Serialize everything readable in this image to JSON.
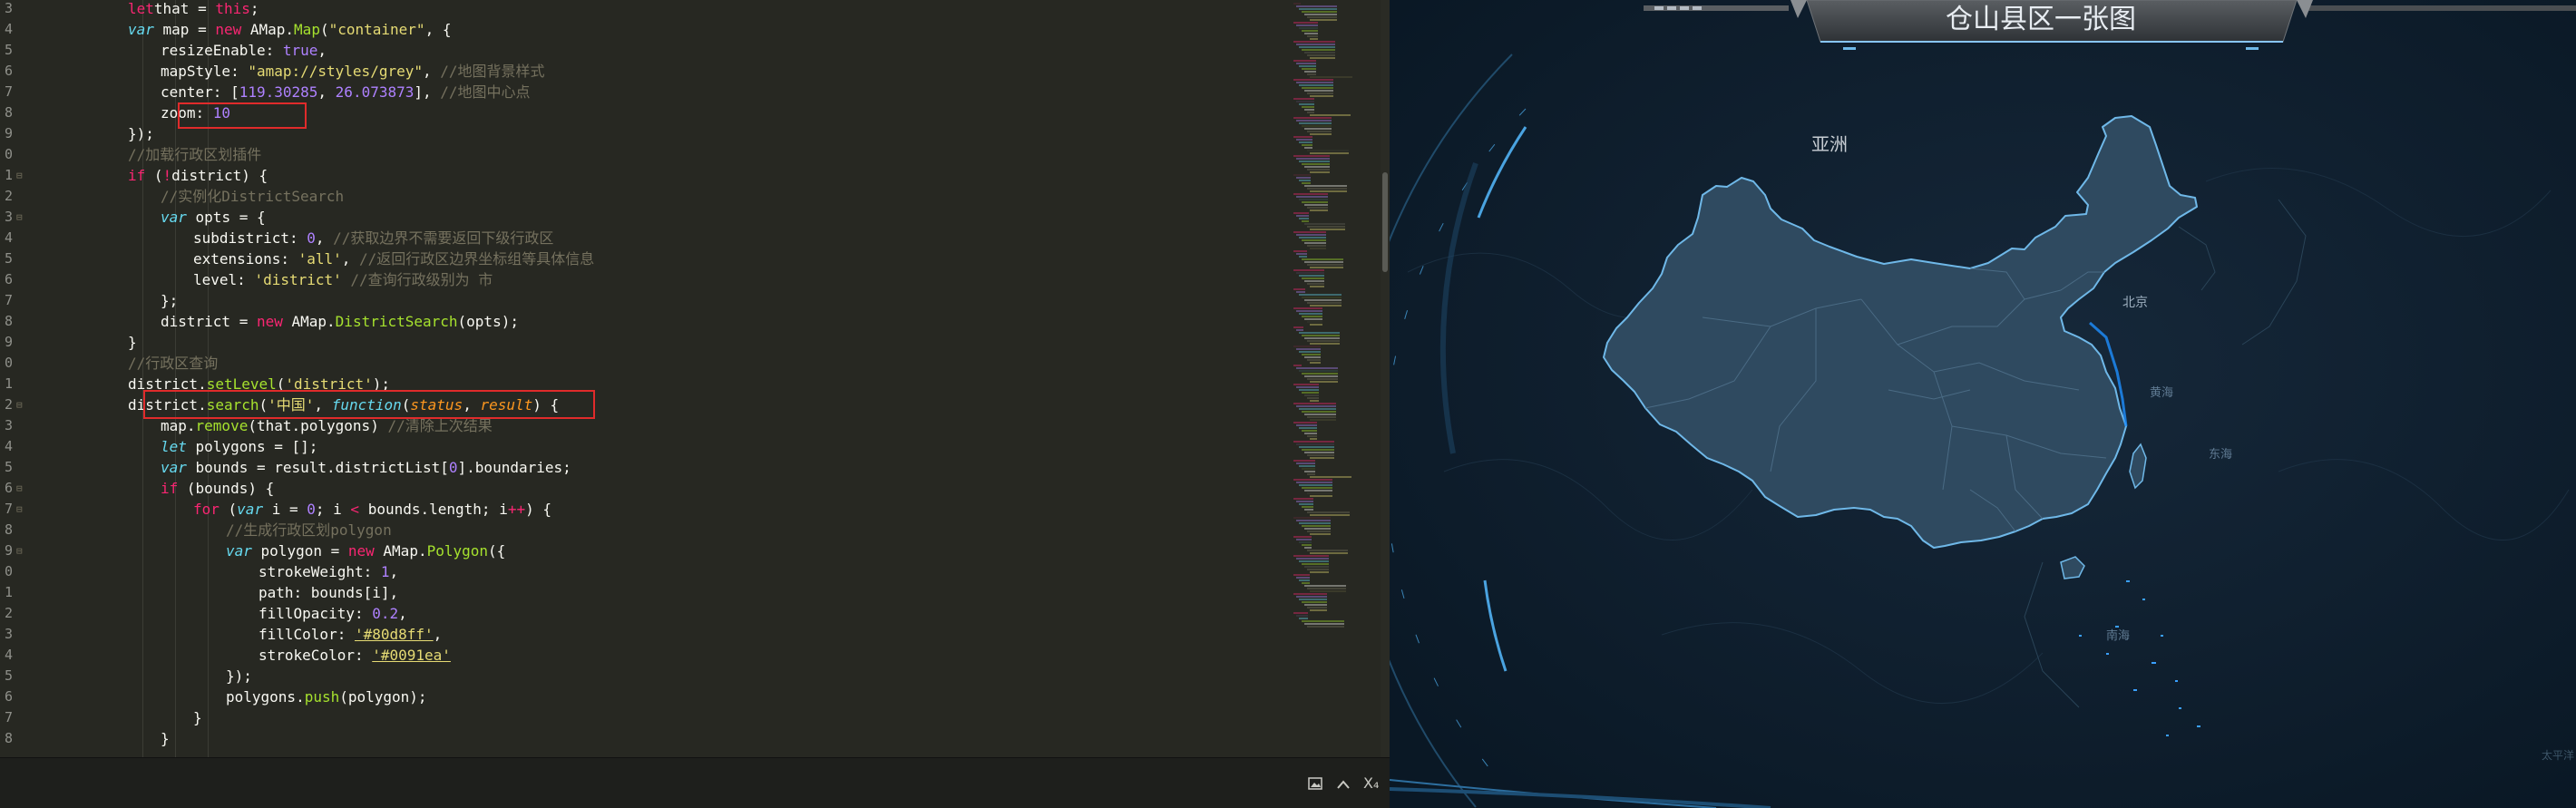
{
  "editor": {
    "lines": [
      {
        "n": "3",
        "fold": "",
        "indent": 0,
        "tokens": [
          [
            "kw",
            "let"
          ],
          [
            "",
            "that = "
          ],
          [
            "kw",
            "this"
          ],
          [
            "",
            ";"
          ]
        ]
      },
      {
        "n": "4",
        "fold": "",
        "indent": 0,
        "tokens": [
          [
            "st",
            "var"
          ],
          [
            "",
            " map = "
          ],
          [
            "kw",
            "new"
          ],
          [
            "",
            " AMap."
          ],
          [
            "fn",
            "Map"
          ],
          [
            "",
            "("
          ],
          [
            "str",
            "\"container\""
          ],
          [
            "",
            ", {"
          ]
        ]
      },
      {
        "n": "5",
        "fold": "",
        "indent": 1,
        "tokens": [
          [
            "",
            "resizeEnable: "
          ],
          [
            "num",
            "true"
          ],
          [
            "",
            ","
          ]
        ]
      },
      {
        "n": "6",
        "fold": "",
        "indent": 1,
        "tokens": [
          [
            "",
            "mapStyle: "
          ],
          [
            "str",
            "\"amap://styles/grey\""
          ],
          [
            "",
            ", "
          ],
          [
            "cm",
            "//地图背景样式"
          ]
        ]
      },
      {
        "n": "7",
        "fold": "",
        "indent": 1,
        "tokens": [
          [
            "",
            "center: ["
          ],
          [
            "num",
            "119.30285"
          ],
          [
            "",
            ", "
          ],
          [
            "num",
            "26.073873"
          ],
          [
            "",
            "], "
          ],
          [
            "cm",
            "//地图中心点"
          ]
        ]
      },
      {
        "n": "8",
        "fold": "",
        "indent": 1,
        "tokens": [
          [
            "",
            "zoom: "
          ],
          [
            "num",
            "10"
          ]
        ]
      },
      {
        "n": "9",
        "fold": "",
        "indent": 0,
        "tokens": [
          [
            "",
            "});"
          ]
        ]
      },
      {
        "n": "0",
        "fold": "",
        "indent": 0,
        "tokens": [
          [
            "cm",
            "//加载行政区划插件"
          ]
        ]
      },
      {
        "n": "1",
        "fold": "⊟",
        "indent": 0,
        "tokens": [
          [
            "kw",
            "if"
          ],
          [
            "",
            " ("
          ],
          [
            "kw",
            "!"
          ],
          [
            "",
            "district) {"
          ]
        ]
      },
      {
        "n": "2",
        "fold": "",
        "indent": 1,
        "tokens": [
          [
            "cm",
            "//实例化DistrictSearch"
          ]
        ]
      },
      {
        "n": "3",
        "fold": "⊟",
        "indent": 1,
        "tokens": [
          [
            "st",
            "var"
          ],
          [
            "",
            " opts = {"
          ]
        ]
      },
      {
        "n": "4",
        "fold": "",
        "indent": 2,
        "tokens": [
          [
            "",
            "subdistrict: "
          ],
          [
            "num",
            "0"
          ],
          [
            "",
            ", "
          ],
          [
            "cm",
            "//获取边界不需要返回下级行政区"
          ]
        ]
      },
      {
        "n": "5",
        "fold": "",
        "indent": 2,
        "tokens": [
          [
            "",
            "extensions: "
          ],
          [
            "str",
            "'all'"
          ],
          [
            "",
            ", "
          ],
          [
            "cm",
            "//返回行政区边界坐标组等具体信息"
          ]
        ]
      },
      {
        "n": "6",
        "fold": "",
        "indent": 2,
        "tokens": [
          [
            "",
            "level: "
          ],
          [
            "str",
            "'district'"
          ],
          [
            "",
            " "
          ],
          [
            "cm",
            "//查询行政级别为 市"
          ]
        ]
      },
      {
        "n": "7",
        "fold": "",
        "indent": 1,
        "tokens": [
          [
            "",
            "};"
          ]
        ]
      },
      {
        "n": "8",
        "fold": "",
        "indent": 1,
        "tokens": [
          [
            "",
            "district = "
          ],
          [
            "kw",
            "new"
          ],
          [
            "",
            " AMap."
          ],
          [
            "fn",
            "DistrictSearch"
          ],
          [
            "",
            "(opts);"
          ]
        ]
      },
      {
        "n": "9",
        "fold": "",
        "indent": 0,
        "tokens": [
          [
            "",
            "}"
          ]
        ]
      },
      {
        "n": "0",
        "fold": "",
        "indent": 0,
        "tokens": [
          [
            "cm",
            "//行政区查询"
          ]
        ]
      },
      {
        "n": "1",
        "fold": "",
        "indent": 0,
        "tokens": [
          [
            "",
            "district."
          ],
          [
            "fn",
            "setLevel"
          ],
          [
            "",
            "("
          ],
          [
            "str",
            "'district'"
          ],
          [
            "",
            ");"
          ]
        ]
      },
      {
        "n": "2",
        "fold": "⊟",
        "indent": 0,
        "tokens": [
          [
            "",
            "district."
          ],
          [
            "fn",
            "search"
          ],
          [
            "",
            "("
          ],
          [
            "str",
            "'中国'"
          ],
          [
            "",
            ", "
          ],
          [
            "st",
            "function"
          ],
          [
            "",
            "("
          ],
          [
            "par",
            "status"
          ],
          [
            "",
            ", "
          ],
          [
            "par",
            "result"
          ],
          [
            "",
            ") {"
          ]
        ]
      },
      {
        "n": "3",
        "fold": "",
        "indent": 1,
        "tokens": [
          [
            "",
            "map."
          ],
          [
            "fn",
            "remove"
          ],
          [
            "",
            "(that.polygons) "
          ],
          [
            "cm",
            "//清除上次结果"
          ]
        ]
      },
      {
        "n": "4",
        "fold": "",
        "indent": 1,
        "tokens": [
          [
            "st",
            "let"
          ],
          [
            "",
            " polygons = [];"
          ]
        ]
      },
      {
        "n": "5",
        "fold": "",
        "indent": 1,
        "tokens": [
          [
            "st",
            "var"
          ],
          [
            "",
            " bounds = result.districtList["
          ],
          [
            "num",
            "0"
          ],
          [
            "",
            "].boundaries;"
          ]
        ]
      },
      {
        "n": "6",
        "fold": "⊟",
        "indent": 1,
        "tokens": [
          [
            "kw",
            "if"
          ],
          [
            "",
            " (bounds) {"
          ]
        ]
      },
      {
        "n": "7",
        "fold": "⊟",
        "indent": 2,
        "tokens": [
          [
            "kw",
            "for"
          ],
          [
            "",
            " ("
          ],
          [
            "st",
            "var"
          ],
          [
            "",
            " i = "
          ],
          [
            "num",
            "0"
          ],
          [
            "",
            "; i "
          ],
          [
            "kw",
            "<"
          ],
          [
            "",
            " bounds.length; i"
          ],
          [
            "kw",
            "++"
          ],
          [
            "",
            ") {"
          ]
        ]
      },
      {
        "n": "8",
        "fold": "",
        "indent": 3,
        "tokens": [
          [
            "cm",
            "//生成行政区划polygon"
          ]
        ]
      },
      {
        "n": "9",
        "fold": "⊟",
        "indent": 3,
        "tokens": [
          [
            "st",
            "var"
          ],
          [
            "",
            " polygon = "
          ],
          [
            "kw",
            "new"
          ],
          [
            "",
            " AMap."
          ],
          [
            "fn",
            "Polygon"
          ],
          [
            "",
            "({"
          ]
        ]
      },
      {
        "n": "0",
        "fold": "",
        "indent": 4,
        "tokens": [
          [
            "",
            "strokeWeight: "
          ],
          [
            "num",
            "1"
          ],
          [
            "",
            ","
          ]
        ]
      },
      {
        "n": "1",
        "fold": "",
        "indent": 4,
        "tokens": [
          [
            "",
            "path: bounds[i],"
          ]
        ]
      },
      {
        "n": "2",
        "fold": "",
        "indent": 4,
        "tokens": [
          [
            "",
            "fillOpacity: "
          ],
          [
            "num",
            "0.2"
          ],
          [
            "",
            ","
          ]
        ]
      },
      {
        "n": "3",
        "fold": "",
        "indent": 4,
        "tokens": [
          [
            "",
            "fillColor: "
          ],
          [
            "str ul",
            "'#80d8ff'"
          ],
          [
            "",
            ","
          ]
        ]
      },
      {
        "n": "4",
        "fold": "",
        "indent": 4,
        "tokens": [
          [
            "",
            "strokeColor: "
          ],
          [
            "str ul",
            "'#0091ea'"
          ]
        ]
      },
      {
        "n": "5",
        "fold": "",
        "indent": 3,
        "tokens": [
          [
            "",
            "});"
          ]
        ]
      },
      {
        "n": "6",
        "fold": "",
        "indent": 3,
        "tokens": [
          [
            "",
            "polygons."
          ],
          [
            "fn",
            "push"
          ],
          [
            "",
            "(polygon);"
          ]
        ]
      },
      {
        "n": "7",
        "fold": "",
        "indent": 2,
        "tokens": [
          [
            "",
            "}"
          ]
        ]
      },
      {
        "n": "8",
        "fold": "",
        "indent": 1,
        "tokens": [
          [
            "",
            "}"
          ]
        ]
      }
    ],
    "status_icons": [
      "image-icon",
      "chevron-up-icon"
    ],
    "status_label": "X₄"
  },
  "map": {
    "title": "仓山县区一张图",
    "labels": {
      "asia": "亚洲",
      "beijing": "北京",
      "yellow_sea": "黄海",
      "east_sea": "东海",
      "south_sea": "南海",
      "pacific": "太平洋"
    },
    "colors": {
      "fill": "#2f4a60",
      "stroke": "#6fb8e8",
      "accent": "#1e90ff",
      "bg": "#0c1c2a"
    }
  }
}
